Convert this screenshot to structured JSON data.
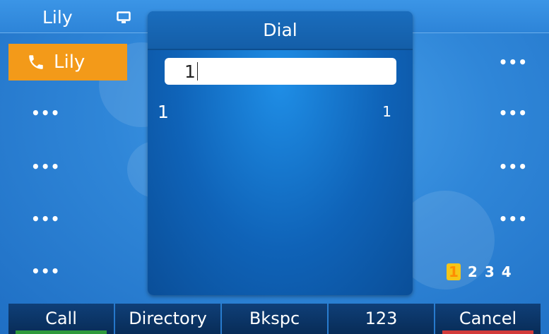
{
  "status": {
    "account": "Lily",
    "icon": "monitor-icon"
  },
  "line_keys": {
    "left": [
      {
        "label": "Lily",
        "icon": "phone-icon",
        "active": true
      },
      {
        "label": "•••"
      },
      {
        "label": "•••"
      },
      {
        "label": "•••"
      },
      {
        "label": "•••"
      }
    ],
    "right": [
      {
        "label": "•••"
      },
      {
        "label": "•••"
      },
      {
        "label": "•••"
      },
      {
        "label": "•••"
      }
    ]
  },
  "dialog": {
    "title": "Dial",
    "input_value": "1",
    "results": [
      {
        "name": "1",
        "number": "1"
      }
    ]
  },
  "pager": {
    "pages": [
      "1",
      "2",
      "3",
      "4"
    ],
    "current": "1"
  },
  "softkeys": [
    {
      "label": "Call",
      "accent": "#2e9a3c"
    },
    {
      "label": "Directory"
    },
    {
      "label": "Bkspc"
    },
    {
      "label": "123"
    },
    {
      "label": "Cancel",
      "accent": "#d23a3a"
    }
  ],
  "colors": {
    "active_line": "#f39a19",
    "page_current_bg": "#f5c518"
  }
}
